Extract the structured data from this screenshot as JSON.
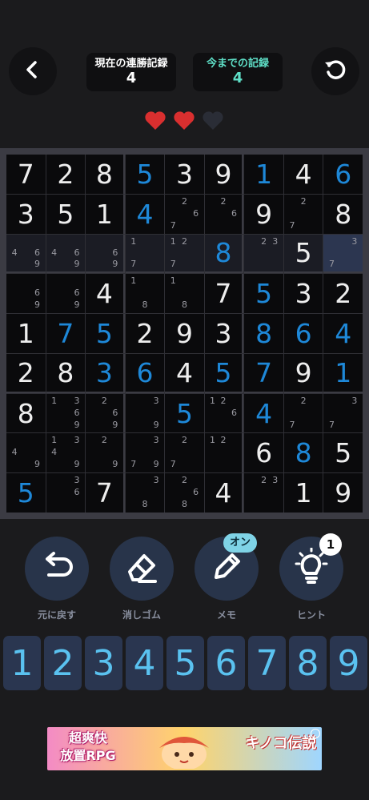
{
  "header": {
    "streak_label": "現在の連勝記録",
    "streak_value": "4",
    "best_label": "今までの記録",
    "best_value": "4",
    "back_icon": "chevron-left-icon",
    "restart_icon": "restart-icon"
  },
  "lives": {
    "total": 3,
    "remaining": 2,
    "colors": {
      "full": "#d92f2f",
      "empty": "#2a2d36"
    }
  },
  "board": {
    "selected": {
      "row": 2,
      "col": 8
    },
    "cells": [
      [
        {
          "v": "7",
          "t": "g"
        },
        {
          "v": "2",
          "t": "g"
        },
        {
          "v": "8",
          "t": "g"
        },
        {
          "v": "5",
          "t": "u"
        },
        {
          "v": "3",
          "t": "g"
        },
        {
          "v": "9",
          "t": "g"
        },
        {
          "v": "1",
          "t": "u"
        },
        {
          "v": "4",
          "t": "g"
        },
        {
          "v": "6",
          "t": "u"
        }
      ],
      [
        {
          "v": "3",
          "t": "g"
        },
        {
          "v": "5",
          "t": "g"
        },
        {
          "v": "1",
          "t": "g"
        },
        {
          "v": "4",
          "t": "u"
        },
        {
          "n": [
            2,
            6,
            7
          ]
        },
        {
          "n": [
            2,
            6
          ]
        },
        {
          "v": "9",
          "t": "g"
        },
        {
          "n": [
            2,
            7
          ]
        },
        {
          "v": "8",
          "t": "g"
        }
      ],
      [
        {
          "n": [
            4,
            6,
            9
          ]
        },
        {
          "n": [
            4,
            6,
            9
          ]
        },
        {
          "n": [
            6,
            9
          ]
        },
        {
          "n": [
            1,
            7
          ]
        },
        {
          "n": [
            1,
            2,
            7
          ]
        },
        {
          "v": "8",
          "t": "u"
        },
        {
          "n": [
            2,
            3
          ]
        },
        {
          "v": "5",
          "t": "g"
        },
        {
          "n": [
            3,
            7
          ]
        }
      ],
      [
        {
          "n": [
            6,
            9
          ]
        },
        {
          "n": [
            6,
            9
          ]
        },
        {
          "v": "4",
          "t": "g"
        },
        {
          "n": [
            1,
            8
          ]
        },
        {
          "n": [
            1,
            8
          ]
        },
        {
          "v": "7",
          "t": "g"
        },
        {
          "v": "5",
          "t": "u"
        },
        {
          "v": "3",
          "t": "g"
        },
        {
          "v": "2",
          "t": "g"
        }
      ],
      [
        {
          "v": "1",
          "t": "g"
        },
        {
          "v": "7",
          "t": "u"
        },
        {
          "v": "5",
          "t": "u"
        },
        {
          "v": "2",
          "t": "g"
        },
        {
          "v": "9",
          "t": "g"
        },
        {
          "v": "3",
          "t": "g"
        },
        {
          "v": "8",
          "t": "u"
        },
        {
          "v": "6",
          "t": "u"
        },
        {
          "v": "4",
          "t": "u"
        }
      ],
      [
        {
          "v": "2",
          "t": "g"
        },
        {
          "v": "8",
          "t": "g"
        },
        {
          "v": "3",
          "t": "u"
        },
        {
          "v": "6",
          "t": "u"
        },
        {
          "v": "4",
          "t": "g"
        },
        {
          "v": "5",
          "t": "u"
        },
        {
          "v": "7",
          "t": "u"
        },
        {
          "v": "9",
          "t": "g"
        },
        {
          "v": "1",
          "t": "u"
        }
      ],
      [
        {
          "v": "8",
          "t": "g"
        },
        {
          "n": [
            1,
            3,
            6,
            9
          ]
        },
        {
          "n": [
            2,
            6,
            9
          ]
        },
        {
          "n": [
            3,
            9
          ]
        },
        {
          "v": "5",
          "t": "u"
        },
        {
          "n": [
            1,
            2,
            6
          ]
        },
        {
          "v": "4",
          "t": "u"
        },
        {
          "n": [
            2,
            7
          ]
        },
        {
          "n": [
            3,
            7
          ]
        }
      ],
      [
        {
          "n": [
            4,
            9
          ]
        },
        {
          "n": [
            1,
            3,
            4,
            9
          ]
        },
        {
          "n": [
            2,
            9
          ]
        },
        {
          "n": [
            3,
            7,
            9
          ]
        },
        {
          "n": [
            2,
            7
          ]
        },
        {
          "n": [
            1,
            2
          ]
        },
        {
          "v": "6",
          "t": "g"
        },
        {
          "v": "8",
          "t": "u"
        },
        {
          "v": "5",
          "t": "g"
        }
      ],
      [
        {
          "v": "5",
          "t": "u"
        },
        {
          "n": [
            3,
            6
          ]
        },
        {
          "v": "7",
          "t": "g"
        },
        {
          "n": [
            3,
            8
          ]
        },
        {
          "n": [
            2,
            6,
            8
          ]
        },
        {
          "v": "4",
          "t": "g"
        },
        {
          "n": [
            2,
            3
          ]
        },
        {
          "v": "1",
          "t": "g"
        },
        {
          "v": "9",
          "t": "g"
        }
      ]
    ]
  },
  "tools": {
    "undo_label": "元に戻す",
    "erase_label": "消しゴム",
    "memo_label": "メモ",
    "memo_badge": "オン",
    "hint_label": "ヒント",
    "hint_badge": "1"
  },
  "numpad": [
    "1",
    "2",
    "3",
    "4",
    "5",
    "6",
    "7",
    "8",
    "9"
  ],
  "ad": {
    "left_line1": "超爽快",
    "left_line2": "放置RPG",
    "right_title": "キノコ伝説",
    "close_icon": "ad-choices-icon"
  },
  "colors": {
    "background": "#1b1b1d",
    "accent_teal": "#5fe0c8",
    "user_digit": "#1e88d8",
    "given_digit": "#eeeeee",
    "numpad_digit": "#5ac2f0"
  }
}
